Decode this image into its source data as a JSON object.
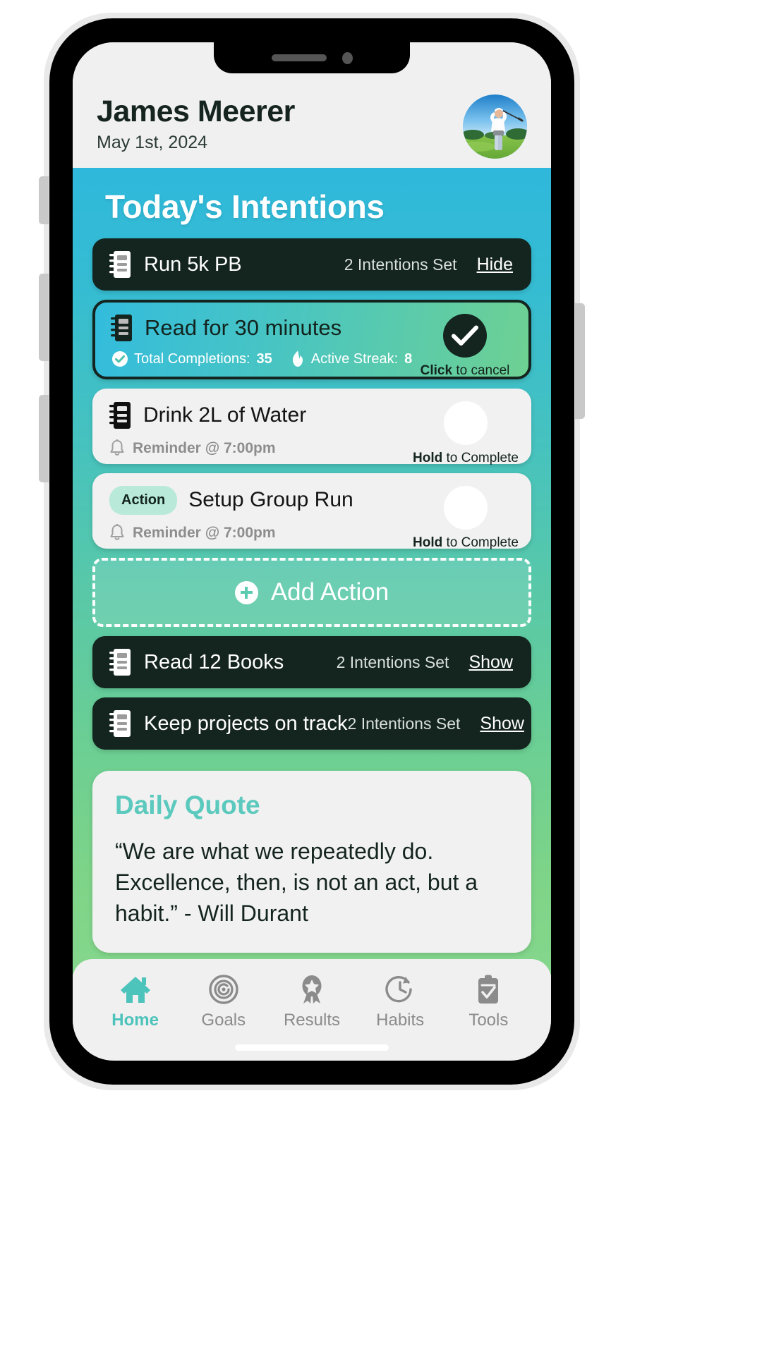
{
  "header": {
    "user_name": "James Meerer",
    "date": "May 1st, 2024",
    "avatar_alt": "golfer-avatar"
  },
  "section": {
    "title": "Today's Intentions"
  },
  "goals": [
    {
      "icon": "notebook-icon",
      "title": "Run 5k PB",
      "meta": "2 Intentions Set",
      "toggle": "Hide"
    },
    {
      "icon": "notebook-icon",
      "title": "Read 12 Books",
      "meta": "2 Intentions Set",
      "toggle": "Show"
    },
    {
      "icon": "notebook-icon",
      "title": "Keep projects on track",
      "meta": "2 Intentions Set",
      "toggle": "Show"
    }
  ],
  "habit_completed": {
    "icon": "notebook-icon",
    "title": "Read for 30 minutes",
    "stats": [
      {
        "icon": "check-circle-icon",
        "label": "Total Completions:",
        "value": "35"
      },
      {
        "icon": "flame-icon",
        "label": "Active Streak:",
        "value": "8"
      }
    ],
    "action_icon": "checkmark-icon",
    "hint_strong": "Click",
    "hint_rest": " to cancel"
  },
  "intentions": [
    {
      "icon": "notebook-icon",
      "badge": null,
      "title": "Drink 2L of Water",
      "reminder_icon": "bell-icon",
      "reminder": "Reminder @ 7:00pm",
      "hint_strong": "Hold",
      "hint_rest": " to Complete"
    },
    {
      "icon": null,
      "badge": "Action",
      "title": "Setup Group Run",
      "reminder_icon": "bell-icon",
      "reminder": "Reminder @ 7:00pm",
      "hint_strong": "Hold",
      "hint_rest": " to Complete"
    }
  ],
  "add_action": {
    "icon": "plus-circle-icon",
    "label": "Add Action"
  },
  "quote": {
    "title": "Daily Quote",
    "text": "“We are what we repeatedly do. Excellence, then, is not an act, but a habit.” - Will Durant"
  },
  "nav": [
    {
      "icon": "home-icon",
      "label": "Home",
      "active": true
    },
    {
      "icon": "target-icon",
      "label": "Goals",
      "active": false
    },
    {
      "icon": "award-icon",
      "label": "Results",
      "active": false
    },
    {
      "icon": "clock-arrow-icon",
      "label": "Habits",
      "active": false
    },
    {
      "icon": "clipboard-check-icon",
      "label": "Tools",
      "active": false
    }
  ],
  "colors": {
    "gradient_top": "#2fb8db",
    "gradient_bottom": "#84d78c",
    "dark_card": "#14241f",
    "accent_teal": "#4cc3bb",
    "quote_title": "#5bc9bd",
    "badge_bg": "#b9ead9",
    "screen_bg": "#f0f0f0"
  }
}
